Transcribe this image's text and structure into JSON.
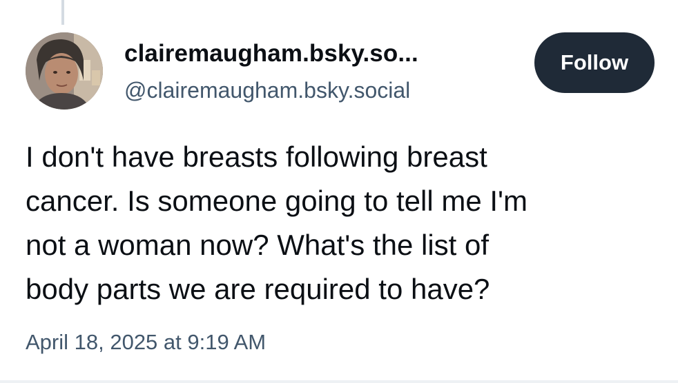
{
  "post": {
    "author": {
      "display_name": "clairemaugham.bsky.so...",
      "handle": "@clairemaugham.bsky.social",
      "avatar_icon": "avatar-photo"
    },
    "follow_label": "Follow",
    "text_lines": [
      "I don't have breasts following breast",
      "cancer. Is someone going to tell me I'm",
      "not a woman now? What's the list of",
      "body parts we are required to have?"
    ],
    "timestamp": "April 18, 2025 at 9:19 AM"
  },
  "colors": {
    "text_primary": "#0b0f14",
    "text_secondary": "#42576c",
    "follow_button_bg": "#1f2a37",
    "follow_button_text": "#ffffff",
    "thread_line": "#d4dbe2"
  }
}
